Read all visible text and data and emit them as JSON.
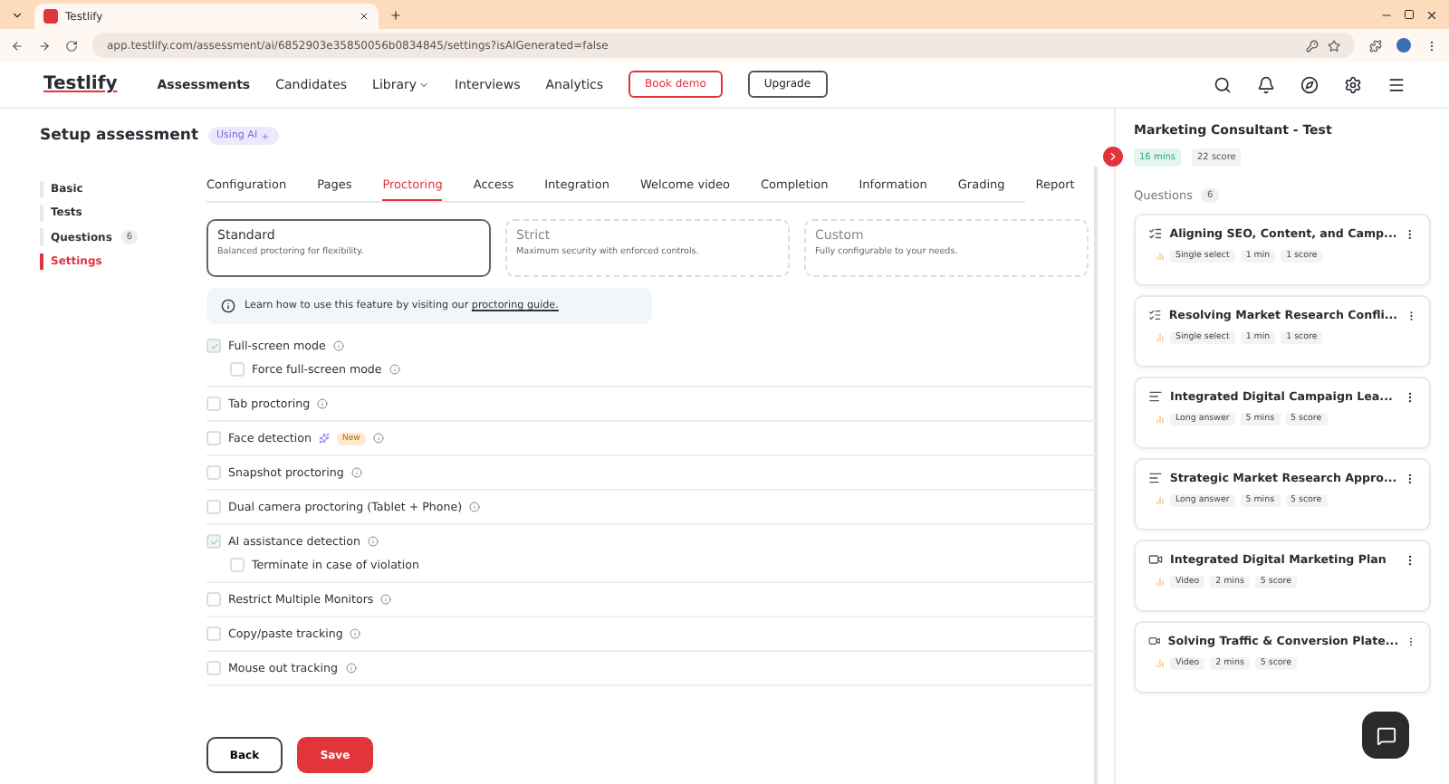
{
  "browser": {
    "tab_title": "Testlify",
    "url": "app.testlify.com/assessment/ai/6852903e35850056b0834845/settings?isAIGenerated=false"
  },
  "nav": {
    "logo": "Testlify",
    "items": [
      {
        "label": "Assessments",
        "selected": true,
        "dropdown": false
      },
      {
        "label": "Candidates",
        "selected": false,
        "dropdown": false
      },
      {
        "label": "Library",
        "selected": false,
        "dropdown": true
      },
      {
        "label": "Interviews",
        "selected": false,
        "dropdown": false
      },
      {
        "label": "Analytics",
        "selected": false,
        "dropdown": false
      }
    ],
    "book_demo": "Book demo",
    "upgrade": "Upgrade"
  },
  "page": {
    "title": "Setup assessment",
    "badge": "Using AI"
  },
  "sidebar": {
    "items": [
      {
        "label": "Basic",
        "selected": false
      },
      {
        "label": "Tests",
        "selected": false
      },
      {
        "label": "Questions",
        "selected": false,
        "count": "6"
      },
      {
        "label": "Settings",
        "selected": true
      }
    ]
  },
  "tabs": [
    {
      "label": "Configuration",
      "selected": false
    },
    {
      "label": "Pages",
      "selected": false
    },
    {
      "label": "Proctoring",
      "selected": true
    },
    {
      "label": "Access",
      "selected": false
    },
    {
      "label": "Integration",
      "selected": false
    },
    {
      "label": "Welcome video",
      "selected": false
    },
    {
      "label": "Completion",
      "selected": false
    },
    {
      "label": "Information",
      "selected": false
    },
    {
      "label": "Grading",
      "selected": false
    },
    {
      "label": "Report",
      "selected": false
    }
  ],
  "modes": [
    {
      "title": "Standard",
      "description": "Balanced proctoring for flexibility.",
      "selected": true
    },
    {
      "title": "Strict",
      "description": "Maximum security with enforced controls.",
      "selected": false
    },
    {
      "title": "Custom",
      "description": "Fully configurable to your needs.",
      "selected": false
    }
  ],
  "info": {
    "text": "Learn how to use this feature by visiting our",
    "link": "proctoring guide."
  },
  "options": [
    {
      "label": "Full-screen mode",
      "checked": true,
      "children": [
        {
          "label": "Force full-screen mode",
          "checked": false
        }
      ]
    },
    {
      "label": "Tab proctoring",
      "checked": false
    },
    {
      "label": "Face detection",
      "checked": false,
      "badge": "New"
    },
    {
      "label": "Snapshot proctoring",
      "checked": false
    },
    {
      "label": "Dual camera proctoring (Tablet + Phone)",
      "checked": false
    },
    {
      "label": "AI assistance detection",
      "checked": true,
      "children": [
        {
          "label": "Terminate in case of violation",
          "checked": false,
          "no_info": true
        }
      ]
    },
    {
      "label": "Restrict Multiple Monitors",
      "checked": false
    },
    {
      "label": "Copy/paste tracking",
      "checked": false
    },
    {
      "label": "Mouse out tracking",
      "checked": false
    }
  ],
  "actions": {
    "back": "Back",
    "save": "Save"
  },
  "summary": {
    "title": "Marketing Consultant - Test",
    "chips": [
      {
        "label": "16 mins",
        "kind": "time"
      },
      {
        "label": "22 score",
        "kind": "score"
      }
    ],
    "questions_label": "Questions",
    "questions_count": "6",
    "questions": [
      {
        "title": "Aligning SEO, Content, and Camp...",
        "kind": "select",
        "tags": [
          "Single select",
          "1 min",
          "1 score"
        ]
      },
      {
        "title": "Resolving Market Research Confli...",
        "kind": "select",
        "tags": [
          "Single select",
          "1 min",
          "1 score"
        ]
      },
      {
        "title": "Integrated Digital Campaign Lea...",
        "kind": "text",
        "tags": [
          "Long answer",
          "5 mins",
          "5 score"
        ]
      },
      {
        "title": "Strategic Market Research Appro...",
        "kind": "text",
        "tags": [
          "Long answer",
          "5 mins",
          "5 score"
        ]
      },
      {
        "title": "Integrated Digital Marketing Plan",
        "kind": "video",
        "tags": [
          "Video",
          "2 mins",
          "5 score"
        ]
      },
      {
        "title": "Solving Traffic & Conversion Plate...",
        "kind": "video",
        "tags": [
          "Video",
          "2 mins",
          "5 score"
        ]
      }
    ]
  }
}
